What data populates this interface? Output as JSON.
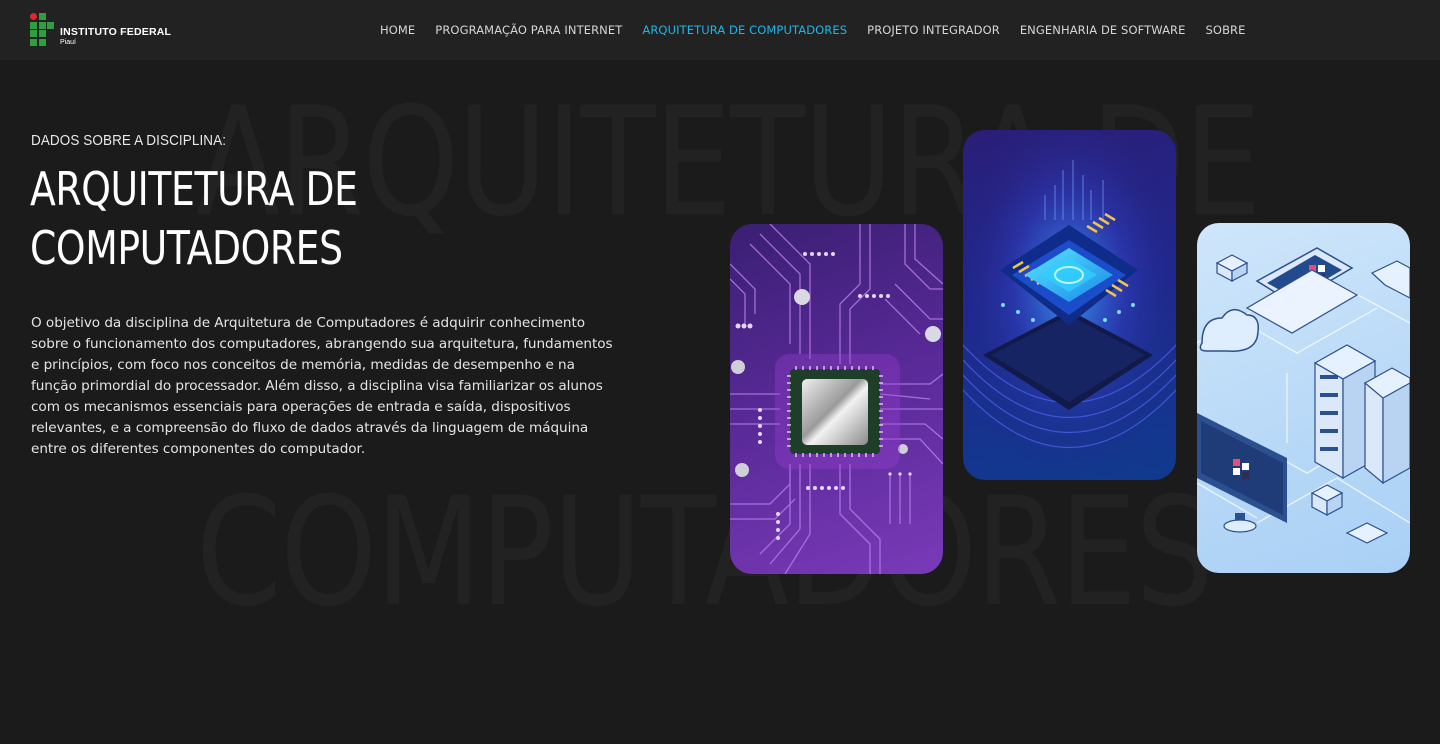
{
  "brand": {
    "title": "INSTITUTO FEDERAL",
    "subtitle": "Piauí",
    "colors": {
      "green": "#2f9e41",
      "red": "#e0262d"
    }
  },
  "nav": {
    "items": [
      {
        "label": "HOME"
      },
      {
        "label": "PROGRAMAÇÃO PARA INTERNET"
      },
      {
        "label": "ARQUITETURA DE COMPUTADORES",
        "active": true
      },
      {
        "label": "PROJETO INTEGRADOR"
      },
      {
        "label": "ENGENHARIA DE SOFTWARE"
      },
      {
        "label": "SOBRE"
      }
    ],
    "active_color": "#1fb6e8"
  },
  "background_text": {
    "line1": "ARQUITETURA DE",
    "line2": "COMPUTADORES"
  },
  "hero": {
    "eyebrow": "DADOS SOBRE A DISCIPLINA:",
    "title_line1": "ARQUITETURA DE",
    "title_line2": "COMPUTADORES",
    "description": "O objetivo da disciplina de Arquitetura de Computadores é adquirir conhecimento sobre o funcionamento dos computadores, abrangendo sua arquitetura, fundamentos e princípios, com foco nos conceitos de memória, medidas de desempenho e na função primordial do processador. Além disso, a disciplina visa familiarizar os alunos com os mecanismos essenciais para operações de entrada e saída, dispositivos relevantes, e a compreensão do fluxo de dados através da linguagem de máquina entre os diferentes componentes do computador."
  },
  "cards": [
    {
      "icon": "circuit-chip-icon"
    },
    {
      "icon": "processor-glow-icon"
    },
    {
      "icon": "network-servers-icon"
    }
  ],
  "theme": {
    "background": "#1b1b1b",
    "navbar": "#222222"
  }
}
